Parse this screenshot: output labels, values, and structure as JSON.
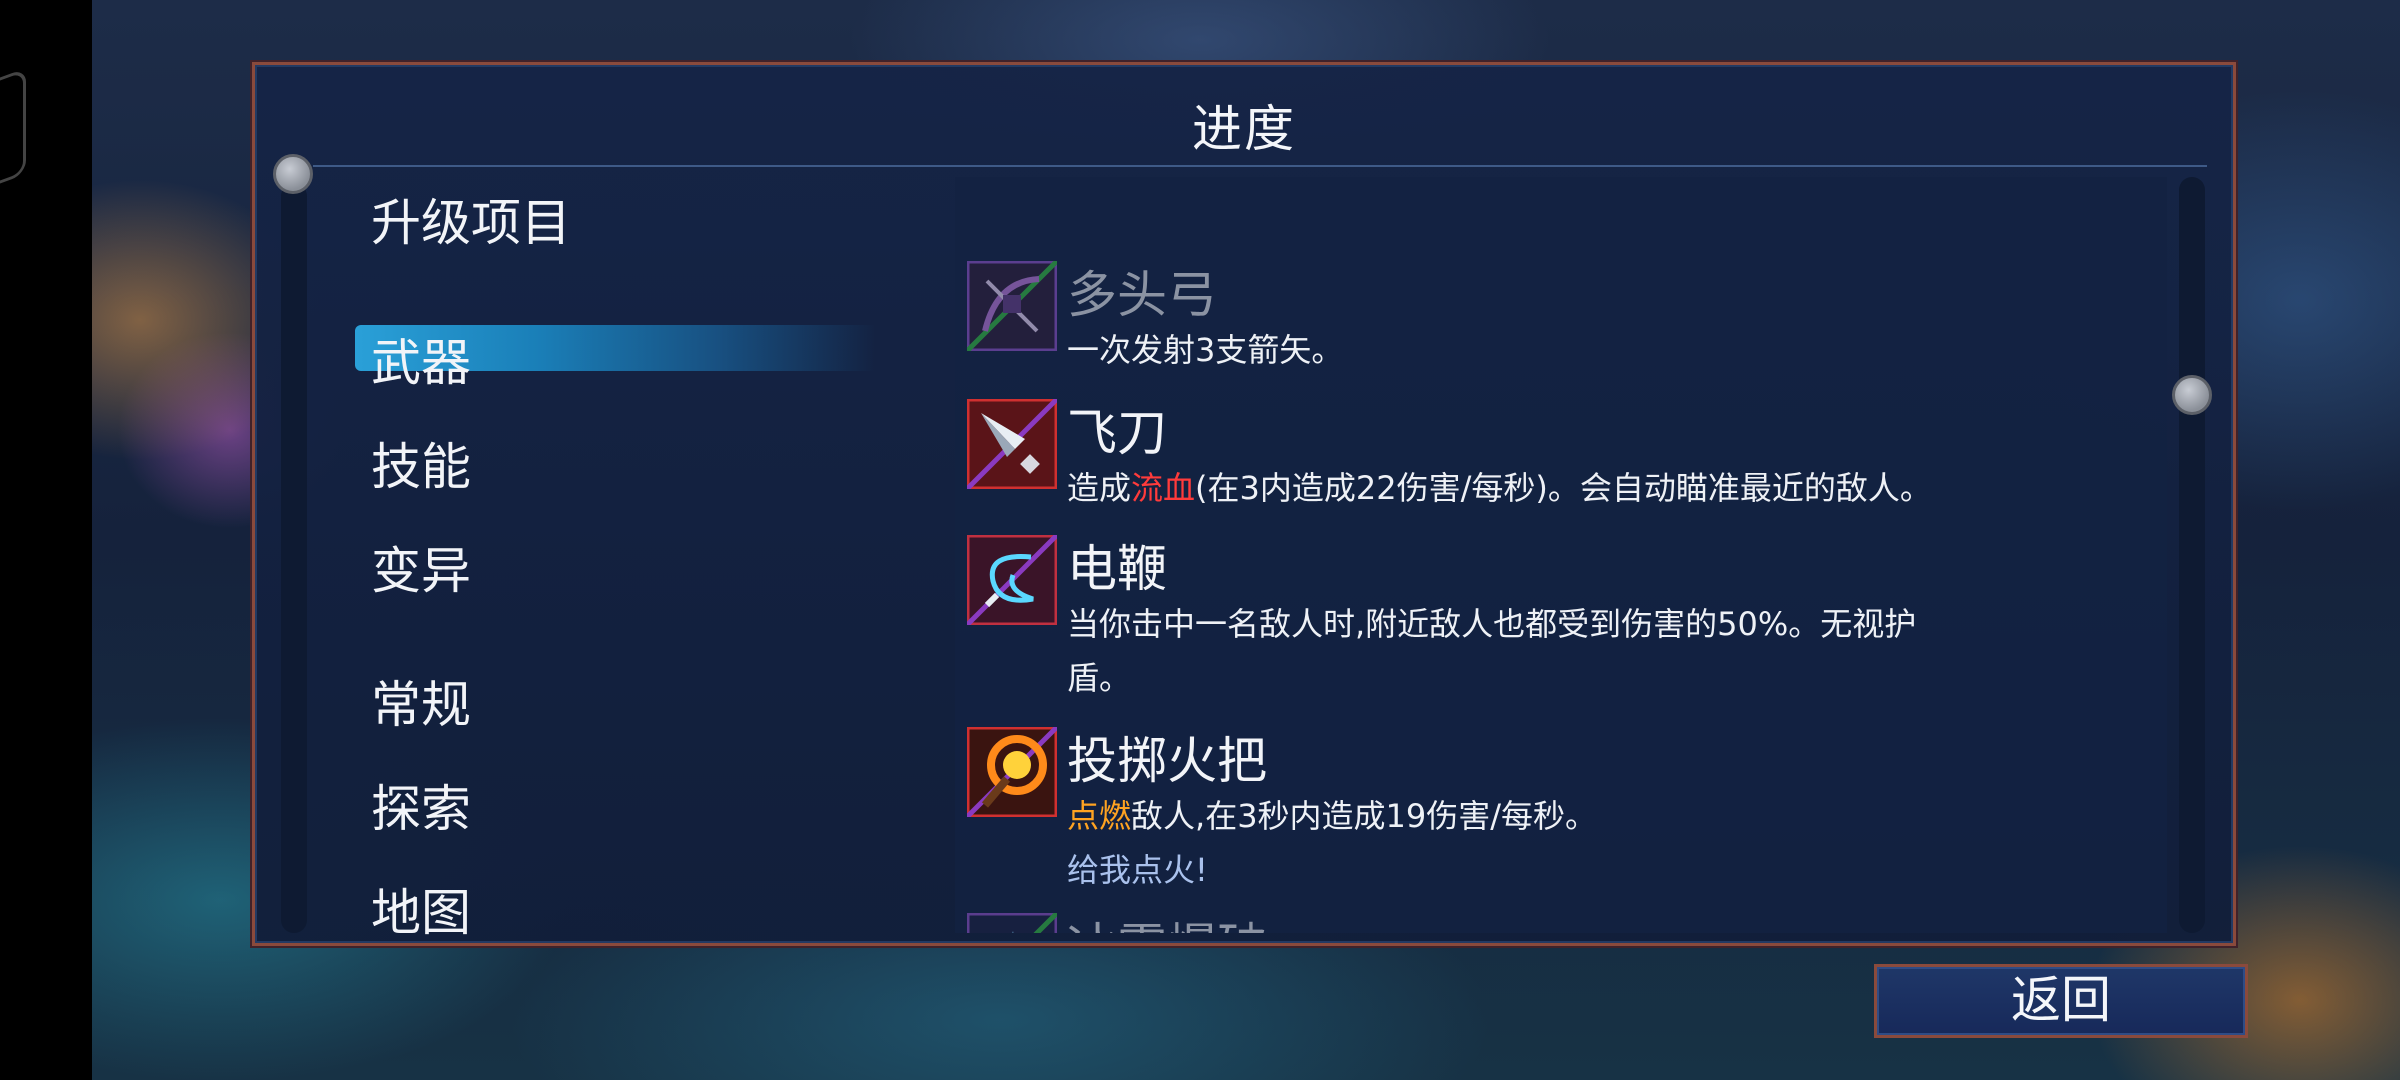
{
  "panel": {
    "title": "进度"
  },
  "categories": {
    "heading": "升级项目",
    "items": [
      {
        "label": "武器",
        "selected": true
      },
      {
        "label": "技能",
        "selected": false
      },
      {
        "label": "变异",
        "selected": false
      },
      {
        "label": "常规",
        "selected": false
      },
      {
        "label": "探索",
        "selected": false
      },
      {
        "label": "地图",
        "selected": false
      }
    ]
  },
  "upgrades": [
    {
      "name": "多头弓",
      "icon": "crossbow-icon",
      "locked": true,
      "desc": "一次发射3支箭矢。"
    },
    {
      "name": "飞刀",
      "icon": "throwing-knife-icon",
      "locked": false,
      "desc_pre": "造成",
      "desc_keyword": "流血",
      "desc_post": "(在3内造成22伤害/每秒)。会自动瞄准最近的敌人。"
    },
    {
      "name": "电鞭",
      "icon": "electric-whip-icon",
      "locked": false,
      "desc_line1": "当你击中一名敌人时,附近敌人也都受到伤害的50%。无视护",
      "desc_line2": "盾。"
    },
    {
      "name": "投掷火把",
      "icon": "torch-icon",
      "locked": false,
      "desc_keyword": "点燃",
      "desc_post": "敌人,在3秒内造成19伤害/每秒。",
      "flavor": "给我点火!"
    },
    {
      "name": "冰霜爆破",
      "icon": "frost-blast-icon",
      "locked": true
    }
  ],
  "footer": {
    "back_label": "返回"
  },
  "colors": {
    "keyword_bleed": "#ff3b3b",
    "keyword_burn": "#ffa321",
    "selected_tab": "#2aa0d8",
    "panel_border": "#8a4a3c"
  }
}
